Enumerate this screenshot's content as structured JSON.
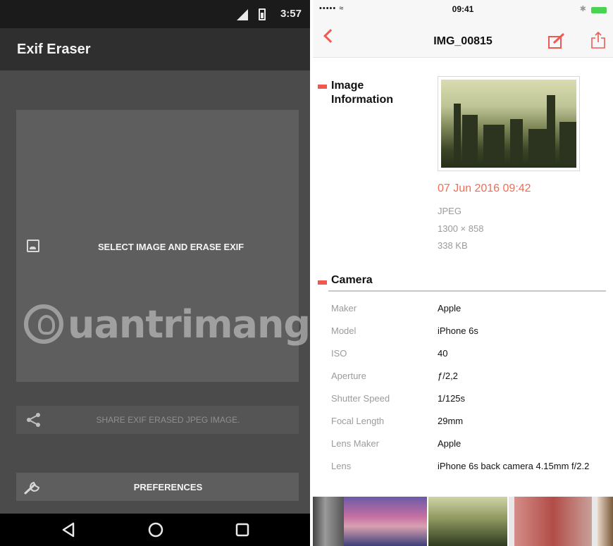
{
  "android": {
    "status_time": "3:57",
    "app_title": "Exif Eraser",
    "select_label": "SELECT IMAGE AND ERASE EXIF",
    "share_label": "SHARE EXIF ERASED JPEG IMAGE.",
    "prefs_label": "PREFERENCES",
    "watermark_text": "uantrimang"
  },
  "ios": {
    "carrier": "••••• ≈",
    "status_time": "09:41",
    "title": "IMG_00815",
    "image_section": {
      "title": "Image Information",
      "date": "07 Jun 2016 09:42",
      "format": "JPEG",
      "dimensions": "1300 × 858",
      "size": "338 KB"
    },
    "camera_section": {
      "title": "Camera",
      "rows": [
        {
          "label": "Maker",
          "value": "Apple"
        },
        {
          "label": "Model",
          "value": "iPhone 6s"
        },
        {
          "label": "ISO",
          "value": "40"
        },
        {
          "label": "Aperture",
          "value": "ƒ/2,2"
        },
        {
          "label": "Shutter Speed",
          "value": "1/125s"
        },
        {
          "label": "Focal Length",
          "value": "29mm"
        },
        {
          "label": "Lens Maker",
          "value": "Apple"
        },
        {
          "label": "Lens",
          "value": "iPhone 6s back camera 4.15mm f/2.2"
        }
      ]
    }
  },
  "colors": {
    "accent": "#f2574f",
    "date": "#f46c55",
    "android_bg": "#4b4b4b",
    "android_toolbar": "#2f2f2f"
  },
  "icons": [
    "signal-icon",
    "battery-icon",
    "image-icon",
    "share-icon",
    "wrench-icon",
    "back-nav-icon",
    "home-nav-icon",
    "recents-nav-icon",
    "back-chevron-icon",
    "edit-icon",
    "export-icon"
  ]
}
